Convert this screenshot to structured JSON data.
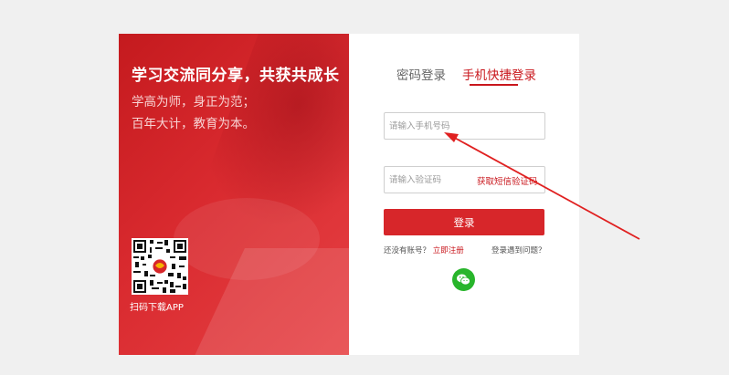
{
  "left": {
    "slogan": "学习交流同分享，共获共成长",
    "motto_line1": "学高为师，身正为范；",
    "motto_line2": "百年大计，教育为本。",
    "qr_caption": "扫码下载APP"
  },
  "tabs": {
    "password_login": "密码登录",
    "phone_login": "手机快捷登录"
  },
  "form": {
    "phone_placeholder": "请输入手机号码",
    "code_placeholder": "请输入验证码",
    "get_code": "获取短信验证码",
    "login": "登录",
    "no_account": "还没有账号？",
    "register": "立即注册",
    "login_problem": "登录遇到问题？"
  },
  "colors": {
    "accent": "#c9171d",
    "button": "#d7262a",
    "wechat": "#28b52b",
    "annotation_arrow": "#e02020"
  },
  "icons": {
    "social_login": "wechat-icon"
  }
}
